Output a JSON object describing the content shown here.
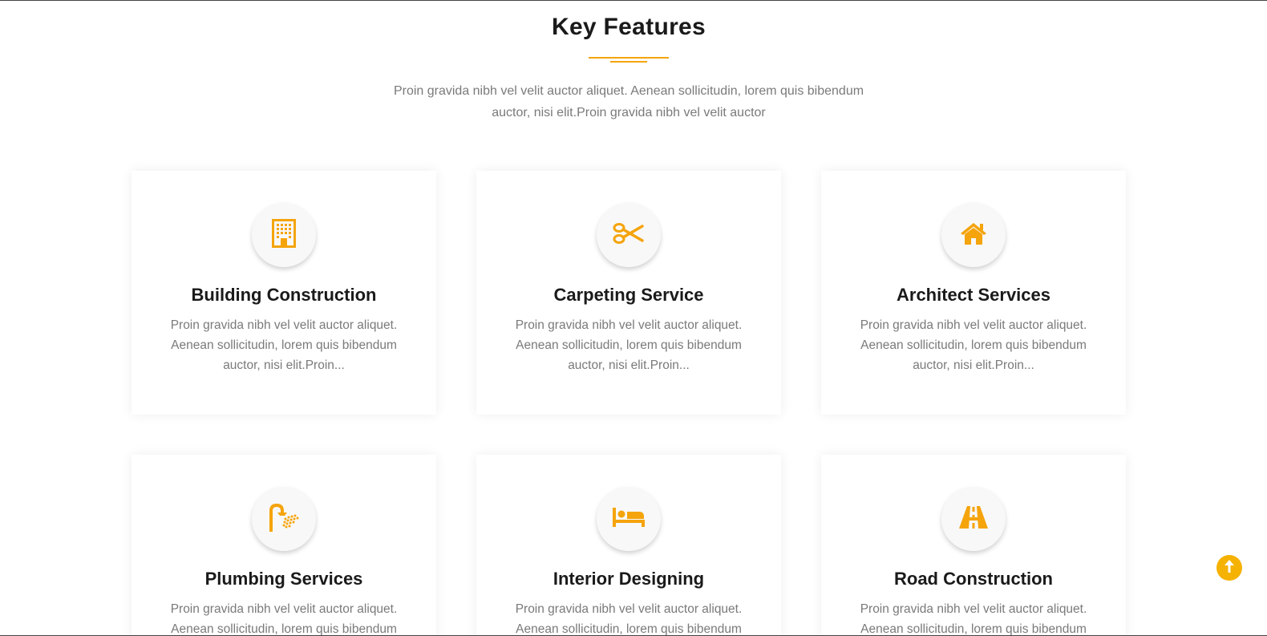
{
  "section": {
    "title": "Key Features",
    "intro": "Proin gravida nibh vel velit auctor aliquet. Aenean sollicitudin, lorem quis bibendum auctor, nisi elit.Proin gravida nibh vel velit auctor"
  },
  "colors": {
    "accent": "#f5a40c",
    "text": "#1a1a1a",
    "muted": "#7a7a7a"
  },
  "cards": [
    {
      "icon": "building-icon",
      "title": "Building Construction",
      "text": "Proin gravida nibh vel velit auctor aliquet. Aenean sollicitudin, lorem quis bibendum auctor, nisi elit.Proin..."
    },
    {
      "icon": "scissors-icon",
      "title": "Carpeting Service",
      "text": "Proin gravida nibh vel velit auctor aliquet. Aenean sollicitudin, lorem quis bibendum auctor, nisi elit.Proin..."
    },
    {
      "icon": "home-icon",
      "title": "Architect Services",
      "text": "Proin gravida nibh vel velit auctor aliquet. Aenean sollicitudin, lorem quis bibendum auctor, nisi elit.Proin..."
    },
    {
      "icon": "shower-icon",
      "title": "Plumbing Services",
      "text": "Proin gravida nibh vel velit auctor aliquet. Aenean sollicitudin, lorem quis bibendum auctor, nisi elit.Proin..."
    },
    {
      "icon": "bed-icon",
      "title": "Interior Designing",
      "text": "Proin gravida nibh vel velit auctor aliquet. Aenean sollicitudin, lorem quis bibendum auctor, nisi elit.Proin..."
    },
    {
      "icon": "road-icon",
      "title": "Road Construction",
      "text": "Proin gravida nibh vel velit auctor aliquet. Aenean sollicitudin, lorem quis bibendum auctor, nisi elit.Proin..."
    }
  ],
  "scroll_top": {
    "icon": "arrow-up-icon"
  }
}
